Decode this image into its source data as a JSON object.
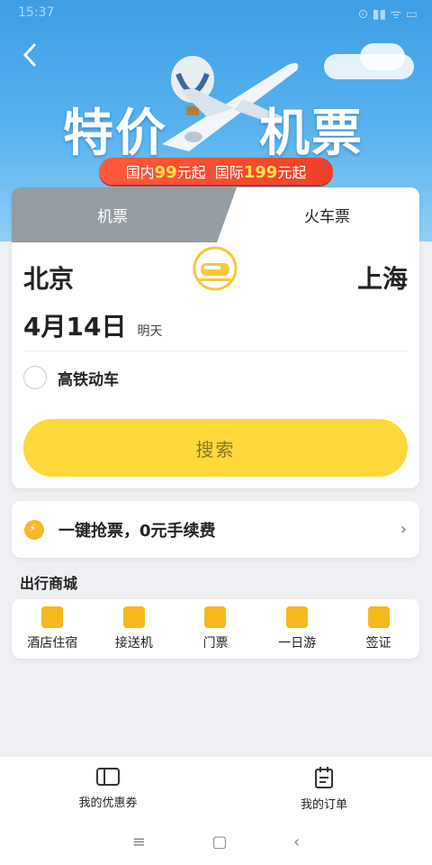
{
  "status_bar": {
    "time": "15:37",
    "icons": "⊙ ▮▮ ᯤ ▭"
  },
  "banner": {
    "title_left": "特价",
    "title_right": "机票",
    "promo_domestic_prefix": "国内",
    "promo_domestic_price": "99",
    "promo_domestic_suffix": "元起",
    "promo_intl_prefix": "国际",
    "promo_intl_price": "199",
    "promo_intl_suffix": "元起"
  },
  "tabs": {
    "flight": "机票",
    "train": "火车票"
  },
  "booking": {
    "from_city": "北京",
    "to_city": "上海",
    "date": "4月14日",
    "weekday": "明天",
    "hsr_option": "高铁动车",
    "search_label": "搜索"
  },
  "grab_ticket": {
    "label": "一键抢票，0元手续费",
    "arrow": "›"
  },
  "travel_mall": {
    "title": "出行商城",
    "items": [
      {
        "label": "酒店住宿"
      },
      {
        "label": "接送机"
      },
      {
        "label": "门票"
      },
      {
        "label": "一日游"
      },
      {
        "label": "签证"
      }
    ]
  },
  "bottom_nav": {
    "coupons": "我的优惠券",
    "orders": "我的订单"
  },
  "system_nav": {
    "menu": "≡",
    "home": "▢",
    "back": "‹"
  },
  "colors": {
    "accent": "#ffd93a",
    "icon": "#f6b81c",
    "promo": "#f0402a"
  }
}
